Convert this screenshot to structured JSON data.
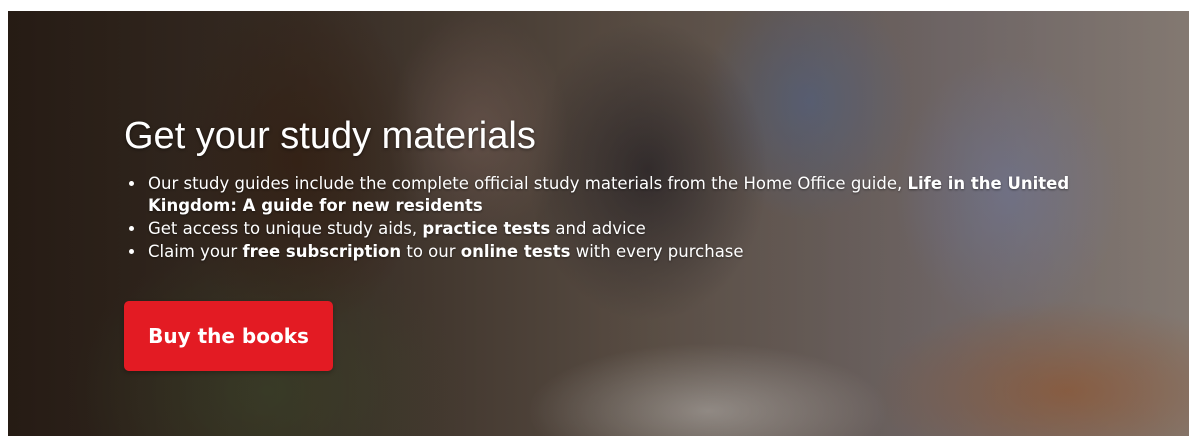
{
  "banner": {
    "title": "Get your study materials",
    "bullets": [
      {
        "before": "Our study guides include the complete official study materials from the Home Office guide, ",
        "bold": "Life in the United Kingdom: A guide for new residents"
      },
      {
        "before": "Get access to unique study aids, ",
        "bold": "practice tests",
        "after": " and advice"
      },
      {
        "before": "Claim your ",
        "bold": "free subscription",
        "middle": " to our ",
        "bold2": "online tests",
        "after": " with every purchase"
      }
    ],
    "button_label": "Buy the books",
    "button_color": "#e31b23",
    "text_color": "#ffffff",
    "background_image": "students-studying-photo"
  }
}
